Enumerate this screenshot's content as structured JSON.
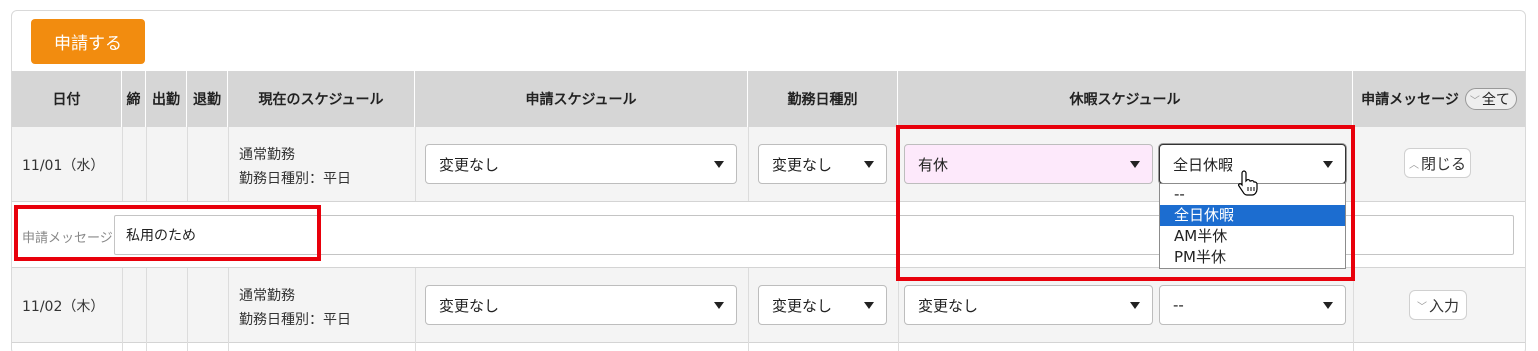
{
  "toolbar": {
    "submit_label": "申請する"
  },
  "columns": {
    "date": "日付",
    "close": "締",
    "clock_in": "出勤",
    "clock_out": "退勤",
    "current_schedule": "現在のスケジュール",
    "request_schedule": "申請スケジュール",
    "workday_type": "勤務日種別",
    "leave_schedule": "休暇スケジュール",
    "request_message": "申請メッセージ",
    "all_label": "全て"
  },
  "rows": [
    {
      "date": "11/01（水）",
      "schedule_line1": "通常勤務",
      "schedule_line2": "勤務日種別：平日",
      "request_schedule": "変更なし",
      "workday_type": "変更なし",
      "leave_type": "有休",
      "leave_period": "全日休暇",
      "toggle_label": "閉じる",
      "message_label": "申請メッセージ:",
      "message_value": "私用のため"
    },
    {
      "date": "11/02（木）",
      "schedule_line1": "通常勤務",
      "schedule_line2": "勤務日種別：平日",
      "request_schedule": "変更なし",
      "workday_type": "変更なし",
      "leave_type": "変更なし",
      "leave_period": "--",
      "toggle_label": "入力"
    }
  ],
  "leave_period_options": [
    "--",
    "全日休暇",
    "AM半休",
    "PM半休"
  ],
  "leave_period_selected_index": 1,
  "colors": {
    "accent": "#f28c0f",
    "highlight": "#e8000b",
    "selected": "#1c6dd0",
    "leave_bg": "#fde9fb"
  }
}
